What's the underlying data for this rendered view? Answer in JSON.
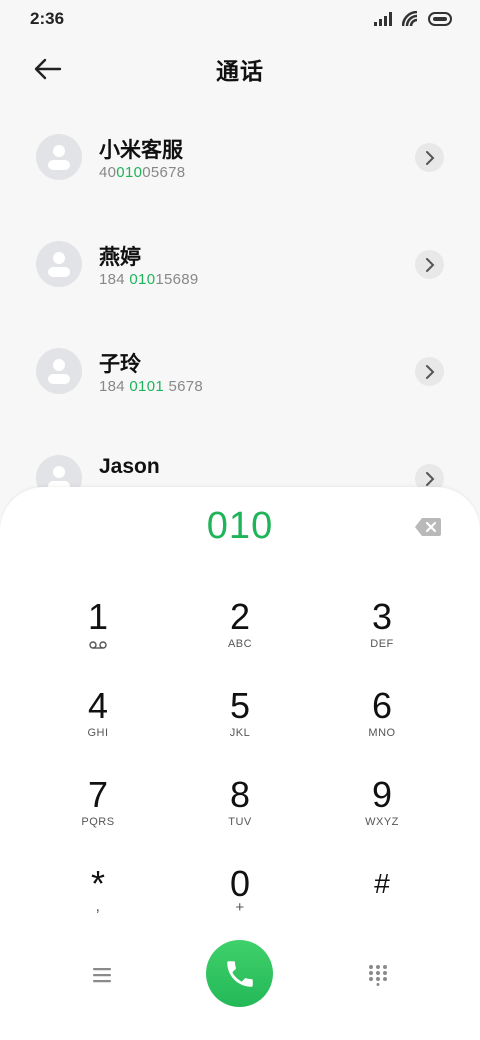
{
  "status": {
    "time": "2:36"
  },
  "header": {
    "title": "通话"
  },
  "contacts": [
    {
      "name": "小米客服",
      "number_pre": "40",
      "number_match": "010",
      "number_post": "05678"
    },
    {
      "name": "燕婷",
      "number_pre": "184 ",
      "number_match": "010",
      "number_post": "15689"
    },
    {
      "name": "子玲",
      "number_pre": "184 ",
      "number_match": "0101",
      "number_post": " 5678"
    },
    {
      "name": "Jason",
      "number_pre": "",
      "number_match": "",
      "number_post": ""
    }
  ],
  "dialer": {
    "input": "010",
    "keys": [
      {
        "digit": "1",
        "sub": "voicemail-icon"
      },
      {
        "digit": "2",
        "sub": "ABC"
      },
      {
        "digit": "3",
        "sub": "DEF"
      },
      {
        "digit": "4",
        "sub": "GHI"
      },
      {
        "digit": "5",
        "sub": "JKL"
      },
      {
        "digit": "6",
        "sub": "MNO"
      },
      {
        "digit": "7",
        "sub": "PQRS"
      },
      {
        "digit": "8",
        "sub": "TUV"
      },
      {
        "digit": "9",
        "sub": "WXYZ"
      },
      {
        "digit": "*",
        "sub": ","
      },
      {
        "digit": "0",
        "sub": "+"
      },
      {
        "digit": "#",
        "sub": ""
      }
    ]
  },
  "colors": {
    "accent": "#1fb35a",
    "call_button": "#2ec35e",
    "avatar_bg": "#e2e3e6"
  },
  "icons": [
    "signal-icon",
    "wifi-icon",
    "battery-icon",
    "back-arrow-icon",
    "chevron-right-icon",
    "backspace-icon",
    "menu-icon",
    "phone-icon",
    "keypad-icon"
  ]
}
